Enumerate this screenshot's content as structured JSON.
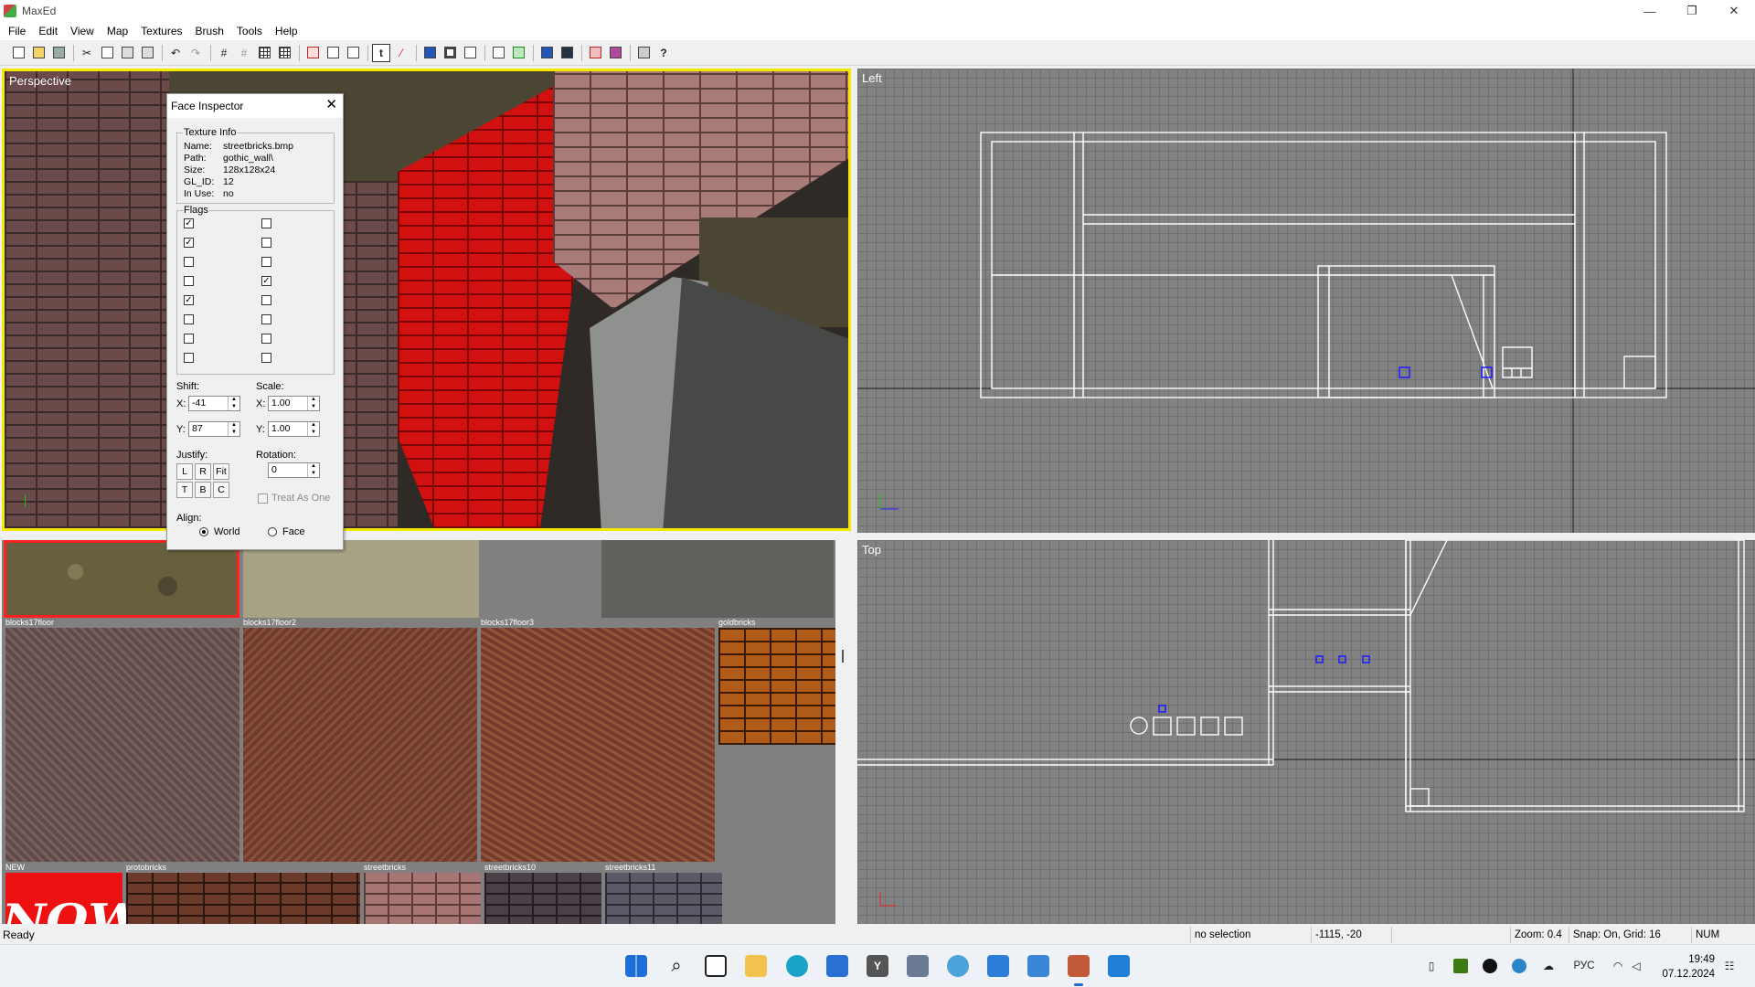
{
  "window": {
    "title": "MaxEd",
    "controls": [
      "—",
      "❐",
      "✕"
    ]
  },
  "menu": [
    "File",
    "Edit",
    "View",
    "Map",
    "Textures",
    "Brush",
    "Tools",
    "Help"
  ],
  "viewports": {
    "perspective": "Perspective",
    "left": "Left",
    "top": "Top"
  },
  "face_inspector": {
    "title": "Face Inspector",
    "texture_info": {
      "title": "Texture Info",
      "rows": [
        {
          "key": "Name:",
          "value": "streetbricks.bmp"
        },
        {
          "key": "Path:",
          "value": "gothic_wall\\"
        },
        {
          "key": "Size:",
          "value": "128x128x24"
        },
        {
          "key": "GL_ID:",
          "value": "12"
        },
        {
          "key": "In Use:",
          "value": "no"
        }
      ]
    },
    "flags": {
      "title": "Flags",
      "left": [
        true,
        true,
        false,
        false,
        true,
        false,
        false,
        false
      ],
      "right": [
        false,
        false,
        false,
        true,
        false,
        false,
        false,
        false
      ]
    },
    "shift": {
      "label": "Shift:",
      "x_label": "X:",
      "x": "-41",
      "y_label": "Y:",
      "y": "87"
    },
    "scale": {
      "label": "Scale:",
      "x_label": "X:",
      "x": "1.00",
      "y_label": "Y:",
      "y": "1.00"
    },
    "justify": {
      "label": "Justify:",
      "buttons": [
        "L",
        "R",
        "Fit",
        "T",
        "B",
        "C"
      ]
    },
    "rotation": {
      "label": "Rotation:",
      "value": "0"
    },
    "treat_as_one": {
      "label": "Treat As One",
      "checked": false
    },
    "align": {
      "label": "Align:",
      "world": "World",
      "face": "Face",
      "selected": "World"
    }
  },
  "textures": [
    {
      "name": "blocks17floor",
      "style": "t-dirt",
      "selected": true
    },
    {
      "name": "blocks17floor2",
      "style": "t-plaster"
    },
    {
      "name": "blocks17floor3",
      "style": "t-stone"
    },
    {
      "name": "goldbricks",
      "style": "t-gold"
    },
    {
      "name": "",
      "style": "t-rust1"
    },
    {
      "name": "",
      "style": "t-rust2"
    },
    {
      "name": "",
      "style": "t-rust3"
    },
    {
      "name": "NEW",
      "style": "t-new",
      "overlay": "NOW"
    },
    {
      "name": "protobricks",
      "style": "t-proto"
    },
    {
      "name": "streetbricks",
      "style": "t-street"
    },
    {
      "name": "streetbricks10",
      "style": "t-street10"
    },
    {
      "name": "streetbricks11",
      "style": "t-street11"
    }
  ],
  "status": {
    "ready": "Ready",
    "selection": "no selection",
    "coords": "-1115, -20",
    "zoom": "Zoom: 0.4",
    "snap": "Snap: On, Grid: 16",
    "num": "NUM"
  },
  "taskbar": {
    "language": "РУС",
    "time": "19:49",
    "date": "07.12.2024"
  },
  "colors": {
    "active_viewport_border": "#f3ea00",
    "wireframe": "#ffffff",
    "selection_handles": "#1a1aff",
    "selected_texture_border": "#ff2020"
  }
}
